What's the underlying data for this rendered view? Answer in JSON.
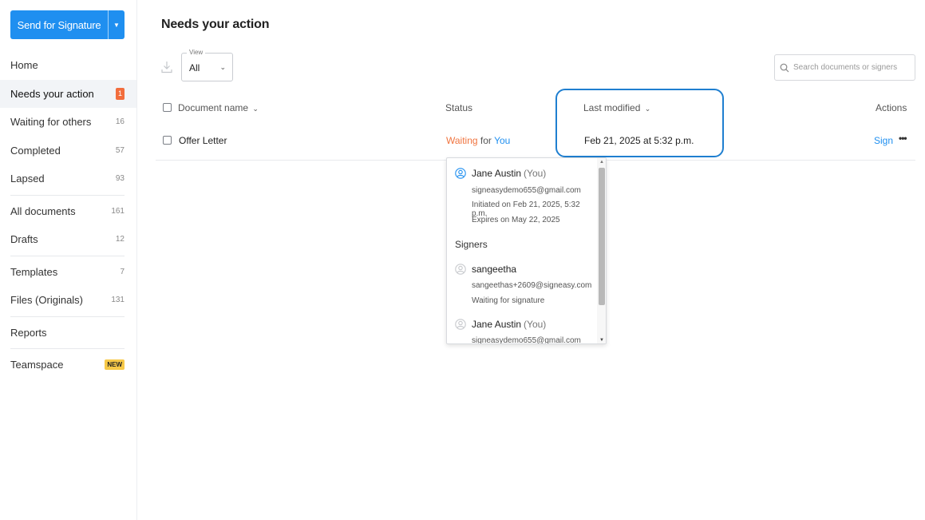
{
  "sidebar": {
    "send_button": "Send for Signature",
    "items": [
      {
        "label": "Home",
        "count": ""
      },
      {
        "label": "Needs your action",
        "count": "1"
      },
      {
        "label": "Waiting for others",
        "count": "16"
      },
      {
        "label": "Completed",
        "count": "57"
      },
      {
        "label": "Lapsed",
        "count": "93"
      },
      {
        "label": "All documents",
        "count": "161"
      },
      {
        "label": "Drafts",
        "count": "12"
      },
      {
        "label": "Templates",
        "count": "7"
      },
      {
        "label": "Files (Originals)",
        "count": "131"
      },
      {
        "label": "Reports",
        "count": ""
      },
      {
        "label": "Teamspace",
        "badge": "NEW"
      }
    ]
  },
  "main": {
    "title": "Needs your action",
    "view": {
      "legend": "View",
      "value": "All"
    },
    "search": {
      "placeholder": "Search documents or signers"
    },
    "columns": {
      "name": "Document name",
      "status": "Status",
      "modified": "Last modified",
      "actions": "Actions"
    },
    "rows": [
      {
        "name": "Offer Letter",
        "status_waiting": "Waiting",
        "status_for": "for",
        "status_you": "You",
        "modified": "Feb 21, 2025 at 5:32 p.m.",
        "action": "Sign"
      }
    ]
  },
  "popover": {
    "owner": {
      "name": "Jane Austin",
      "you": "(You)",
      "email": "signeasydemo655@gmail.com",
      "initiated": "Initiated on Feb 21, 2025, 5:32 p.m.",
      "expires": "Expires on May 22, 2025"
    },
    "signers_heading": "Signers",
    "signers": [
      {
        "name": "sangeetha",
        "you": "",
        "email": "sangeethas+2609@signeasy.com",
        "status": "Waiting for signature"
      },
      {
        "name": "Jane Austin",
        "you": "(You)",
        "email": "signeasydemo655@gmail.com"
      }
    ]
  },
  "colors": {
    "accent": "#1f8ff0",
    "waiting": "#f0743f",
    "badge": "#f26d3d",
    "new_badge": "#f7c948"
  },
  "icons": [
    "caret-down-icon",
    "download-icon",
    "search-icon",
    "user-icon",
    "more-icon"
  ]
}
